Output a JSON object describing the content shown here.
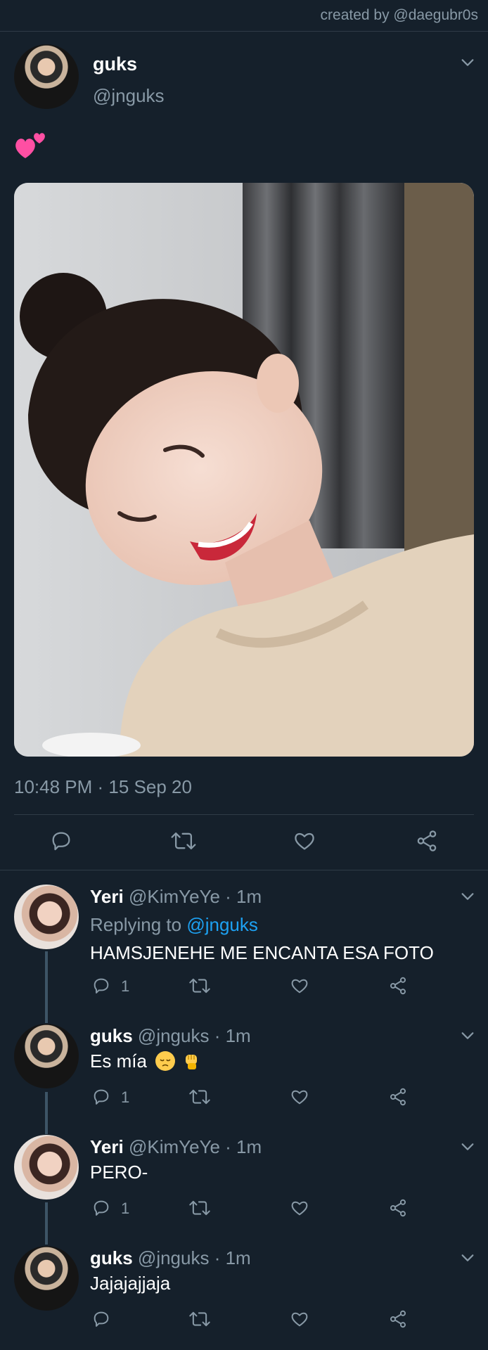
{
  "credit": "created by @daegubr0s",
  "tweet": {
    "name": "guks",
    "handle": "@jnguks",
    "text_emoji": "two-hearts",
    "timestamp": "10:48 PM · 15 Sep 20"
  },
  "replies": [
    {
      "name": "Yeri",
      "meta": "@KimYeYe · 1m",
      "replying_prefix": "Replying to",
      "replying_to": "@jnguks",
      "text": "HAMSJENEHE ME ENCANTA ESA FOTO",
      "reply_count": "1"
    },
    {
      "name": "guks",
      "meta": "@jnguks · 1m",
      "text": "Es mía",
      "reply_count": "1"
    },
    {
      "name": "Yeri",
      "meta": "@KimYeYe · 1m",
      "text": "PERO-",
      "reply_count": "1"
    },
    {
      "name": "guks",
      "meta": "@jnguks · 1m",
      "text": "Jajajajjaja",
      "reply_count": ""
    }
  ],
  "icons": {
    "reply": "speech-bubble-icon",
    "retweet": "retweet-arrows-icon",
    "like": "heart-outline-icon",
    "share": "share-nodes-icon",
    "menu": "chevron-down-icon"
  },
  "colors": {
    "background": "#15202b",
    "muted": "#8899a6",
    "link": "#1da1f2",
    "divider": "#2f3b47"
  }
}
